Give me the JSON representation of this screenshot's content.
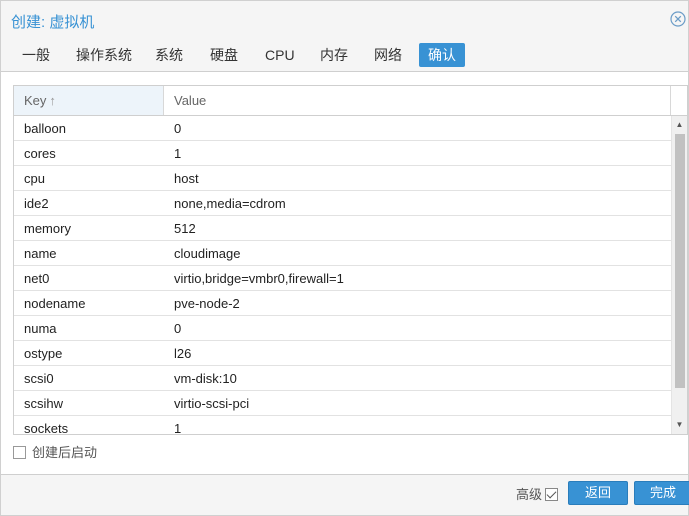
{
  "window": {
    "title": "创建: 虚拟机"
  },
  "tabs": [
    {
      "label": "一般"
    },
    {
      "label": "操作系统"
    },
    {
      "label": "系统"
    },
    {
      "label": "硬盘"
    },
    {
      "label": "CPU"
    },
    {
      "label": "内存"
    },
    {
      "label": "网络"
    },
    {
      "label": "确认",
      "active": true
    }
  ],
  "grid": {
    "columns": {
      "key": "Key",
      "value": "Value"
    },
    "sort_arrow": "↑",
    "rows": [
      {
        "key": "balloon",
        "value": "0"
      },
      {
        "key": "cores",
        "value": "1"
      },
      {
        "key": "cpu",
        "value": "host"
      },
      {
        "key": "ide2",
        "value": "none,media=cdrom"
      },
      {
        "key": "memory",
        "value": "512"
      },
      {
        "key": "name",
        "value": "cloudimage"
      },
      {
        "key": "net0",
        "value": "virtio,bridge=vmbr0,firewall=1"
      },
      {
        "key": "nodename",
        "value": "pve-node-2"
      },
      {
        "key": "numa",
        "value": "0"
      },
      {
        "key": "ostype",
        "value": "l26"
      },
      {
        "key": "scsi0",
        "value": "vm-disk:10"
      },
      {
        "key": "scsihw",
        "value": "virtio-scsi-pci"
      },
      {
        "key": "sockets",
        "value": "1"
      }
    ]
  },
  "start_after_created": {
    "label": "创建后启动",
    "checked": false
  },
  "footer": {
    "advanced_label": "高级",
    "advanced_checked": true,
    "back_label": "返回",
    "finish_label": "完成"
  },
  "colors": {
    "accent": "#3892d4",
    "header_bg": "#edf4fa"
  }
}
